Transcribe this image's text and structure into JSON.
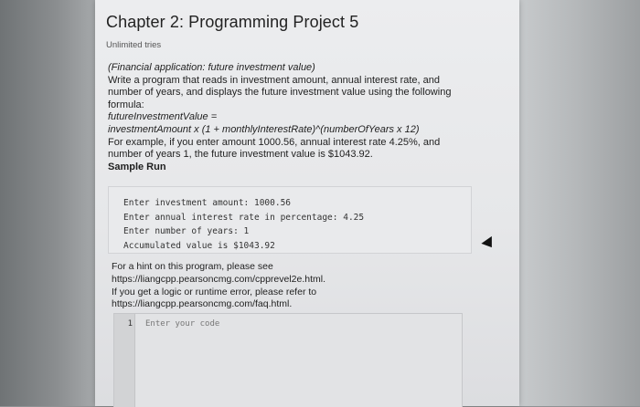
{
  "title": "Chapter 2: Programming Project 5",
  "tries": "Unlimited tries",
  "description": {
    "subtitle": "(Financial application: future investment value)",
    "body": "Write a program that reads in investment amount, annual interest rate, and number of years, and displays the future investment value using the following formula:",
    "formula_line1": "futureInvestmentValue =",
    "formula_line2": "investmentAmount x (1 + monthlyInterestRate)^(numberOfYears x 12)",
    "example": "For example, if you enter amount 1000.56, annual interest rate 4.25%, and number of years 1, the future investment value is $1043.92.",
    "sample_heading": "Sample Run"
  },
  "sample_run": [
    "Enter investment amount: 1000.56",
    "Enter annual interest rate in percentage: 4.25",
    "Enter number of years: 1",
    "Accumulated value is $1043.92"
  ],
  "hint": {
    "line1": "For a hint on this program, please see",
    "link1": "https://liangcpp.pearsoncmg.com/cpprevel2e.html.",
    "line2": "If you get a logic or runtime error, please refer to",
    "link2": "https://liangcpp.pearsoncmg.com/faq.html."
  },
  "editor": {
    "line_number": "1",
    "placeholder": "Enter your code"
  }
}
